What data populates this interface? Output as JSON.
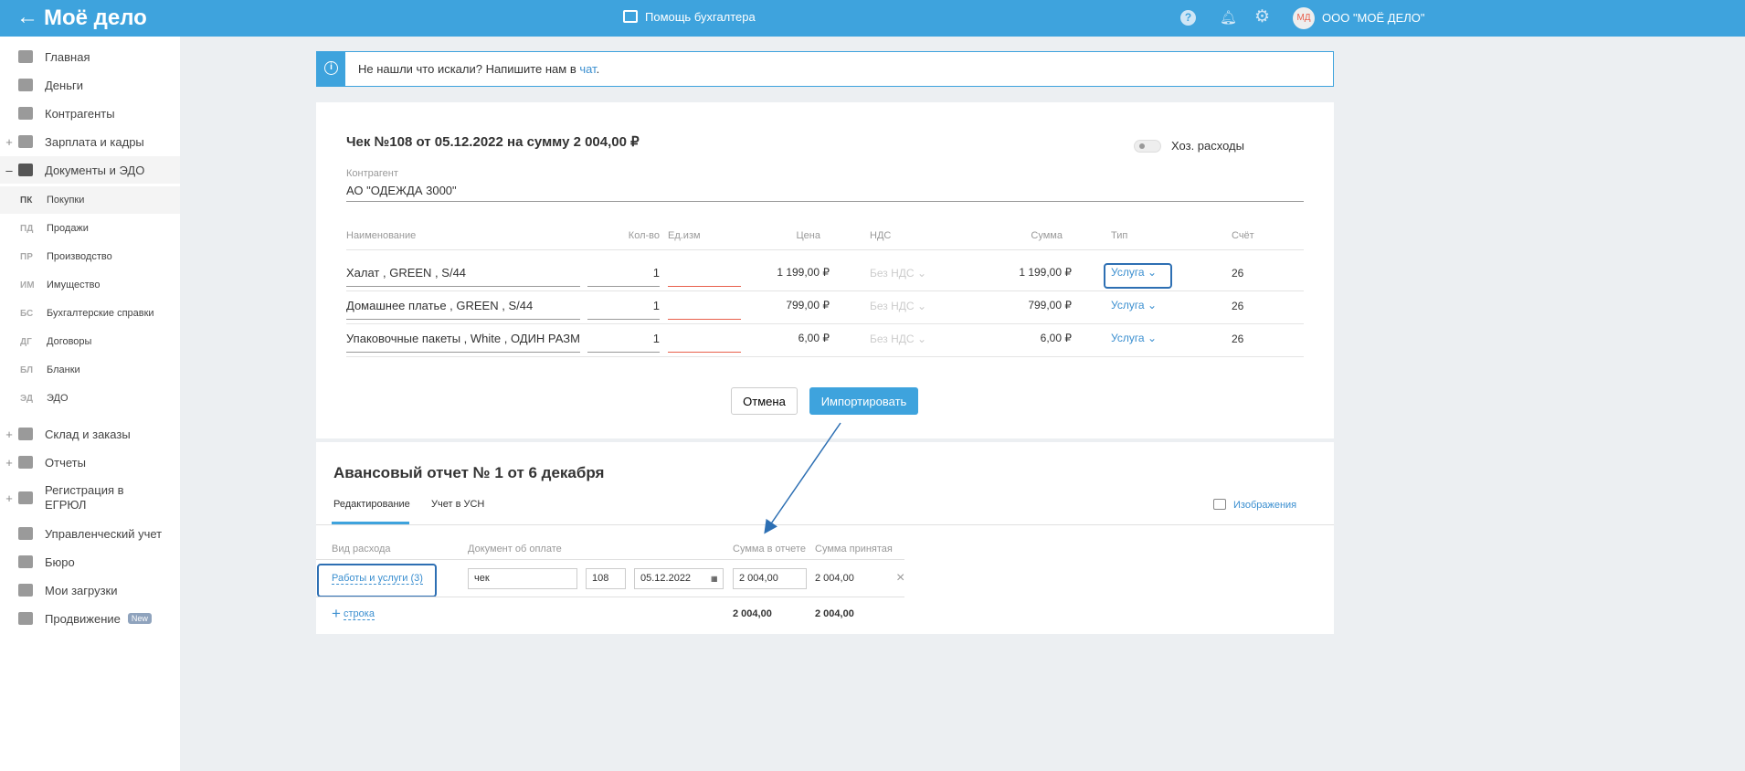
{
  "header": {
    "logo": "Моё дело",
    "center": "Помощь бухгалтера",
    "avatar": "МД",
    "company": "ООО \"МОЁ ДЕЛО\""
  },
  "sidebar": {
    "items": [
      {
        "label": "Главная",
        "prefix": ""
      },
      {
        "label": "Деньги",
        "prefix": ""
      },
      {
        "label": "Контрагенты",
        "prefix": ""
      },
      {
        "label": "Зарплата и кадры",
        "prefix": "+"
      },
      {
        "label": "Документы и ЭДО",
        "prefix": "–"
      }
    ],
    "sub": [
      {
        "abbr": "ПК",
        "label": "Покупки"
      },
      {
        "abbr": "ПД",
        "label": "Продажи"
      },
      {
        "abbr": "ПР",
        "label": "Производство"
      },
      {
        "abbr": "ИМ",
        "label": "Имущество"
      },
      {
        "abbr": "БС",
        "label": "Бухгалтерские справки"
      },
      {
        "abbr": "ДГ",
        "label": "Договоры"
      },
      {
        "abbr": "БЛ",
        "label": "Бланки"
      },
      {
        "abbr": "ЭД",
        "label": "ЭДО"
      }
    ],
    "items2": [
      {
        "label": "Склад и заказы",
        "prefix": "+"
      },
      {
        "label": "Отчеты",
        "prefix": "+"
      },
      {
        "label": "Регистрация в ЕГРЮЛ",
        "prefix": "+"
      },
      {
        "label": "Управленческий учет",
        "prefix": ""
      },
      {
        "label": "Бюро",
        "prefix": ""
      },
      {
        "label": "Мои загрузки",
        "prefix": ""
      },
      {
        "label": "Продвижение",
        "prefix": ""
      }
    ],
    "new_badge": "New"
  },
  "info": {
    "text": "Не нашли что искали? Напишите нам в ",
    "link": "чат",
    "end": "."
  },
  "receipt": {
    "title": "Чек №108 от 05.12.2022 на сумму 2 004,00 ₽",
    "toggle_label": "Хоз. расходы",
    "toggle_on": false,
    "counterparty_label": "Контрагент",
    "counterparty": "АО \"ОДЕЖДА 3000\"",
    "columns": [
      "Наименование",
      "Кол-во",
      "Ед.изм",
      "Цена",
      "НДС",
      "Сумма",
      "Тип",
      "Счёт"
    ],
    "rows": [
      {
        "name": "Халат , GREEN , S/44",
        "qty": "1",
        "unit": "",
        "price": "1 199,00 ₽",
        "vat": "Без НДС",
        "sum": "1 199,00 ₽",
        "type": "Услуга",
        "account": "26"
      },
      {
        "name": "Домашнее платье , GREEN , S/44",
        "qty": "1",
        "unit": "",
        "price": "799,00 ₽",
        "vat": "Без НДС",
        "sum": "799,00 ₽",
        "type": "Услуга",
        "account": "26"
      },
      {
        "name": "Упаковочные пакеты , White , ОДИН РАЗМЕР",
        "qty": "1",
        "unit": "",
        "price": "6,00 ₽",
        "vat": "Без НДС",
        "sum": "6,00 ₽",
        "type": "Услуга",
        "account": "26"
      }
    ],
    "cancel": "Отмена",
    "import": "Импортировать"
  },
  "report": {
    "title": "Авансовый отчет № 1 от 6 декабря",
    "tabs": [
      "Редактирование",
      "Учет в УСН"
    ],
    "images": "Изображения",
    "columns": [
      "Вид расхода",
      "Документ об оплате",
      "Сумма в отчете",
      "Сумма принятая"
    ],
    "row": {
      "kind": "Работы и услуги (3)",
      "doc": "чек",
      "number": "108",
      "date": "05.12.2022",
      "sum": "2 004,00",
      "accepted": "2 004,00"
    },
    "add_row": "строка",
    "total_sum": "2 004,00",
    "total_accepted": "2 004,00"
  }
}
